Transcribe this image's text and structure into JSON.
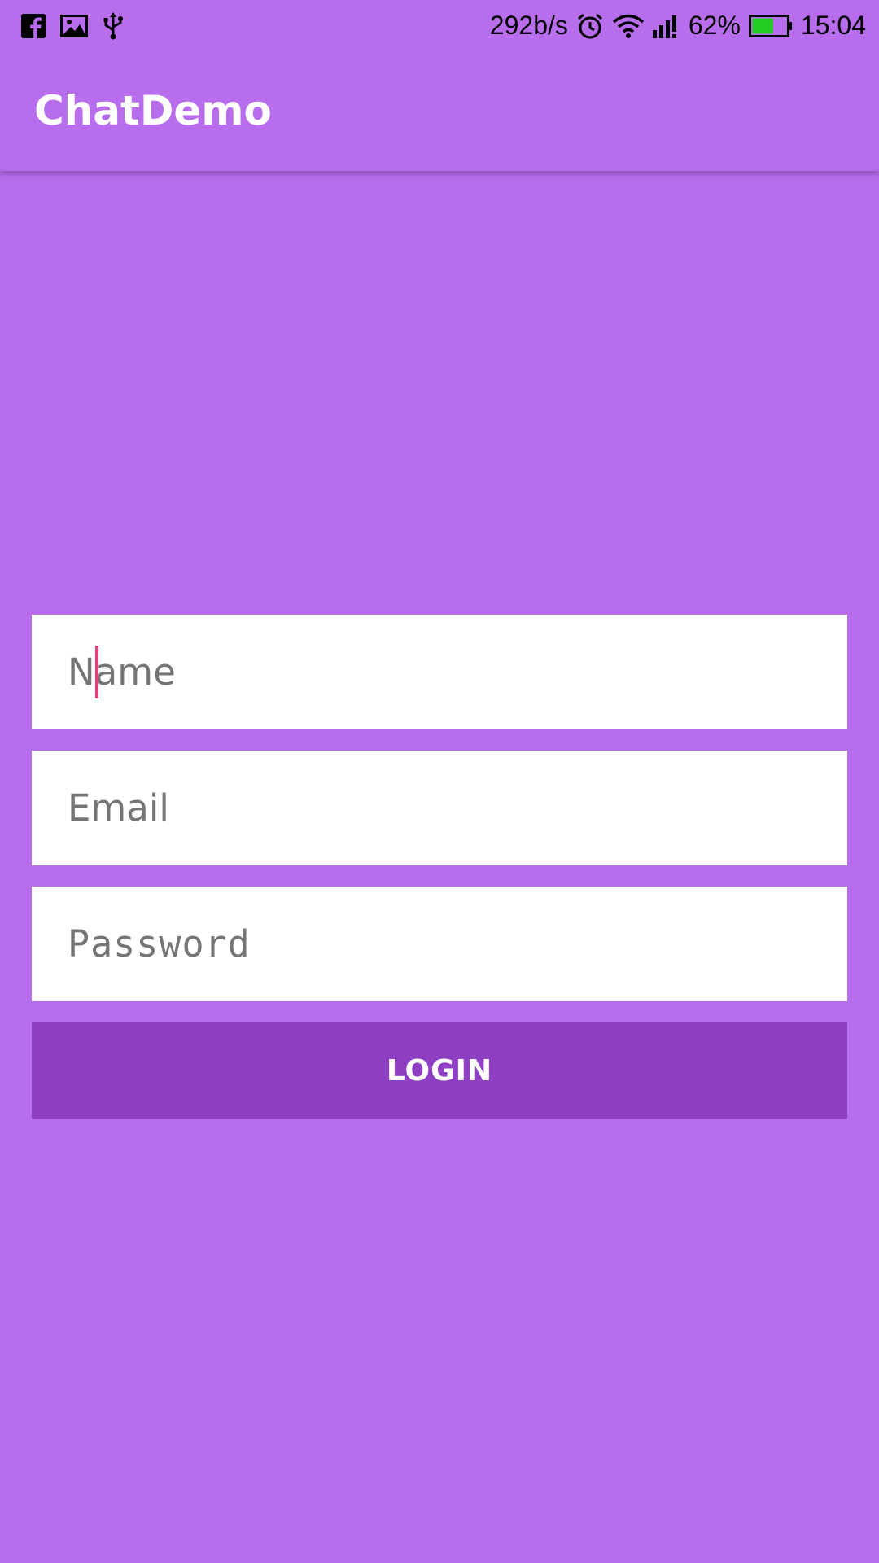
{
  "status_bar": {
    "left_icons": [
      "facebook-icon",
      "gallery-icon",
      "usb-icon"
    ],
    "net_speed": "292b/s",
    "battery_percent": "62%",
    "battery_level": 0.62,
    "time": "15:04",
    "right_icons": [
      "alarm-icon",
      "wifi-icon",
      "signal-icon",
      "battery-icon"
    ]
  },
  "app_bar": {
    "title": "ChatDemo"
  },
  "form": {
    "name_placeholder": "Name",
    "email_placeholder": "Email",
    "password_placeholder": "Password",
    "login_label": "LOGIN"
  },
  "colors": {
    "background": "#b86ded",
    "button": "#8e3fc3",
    "caret": "#e0407a"
  }
}
